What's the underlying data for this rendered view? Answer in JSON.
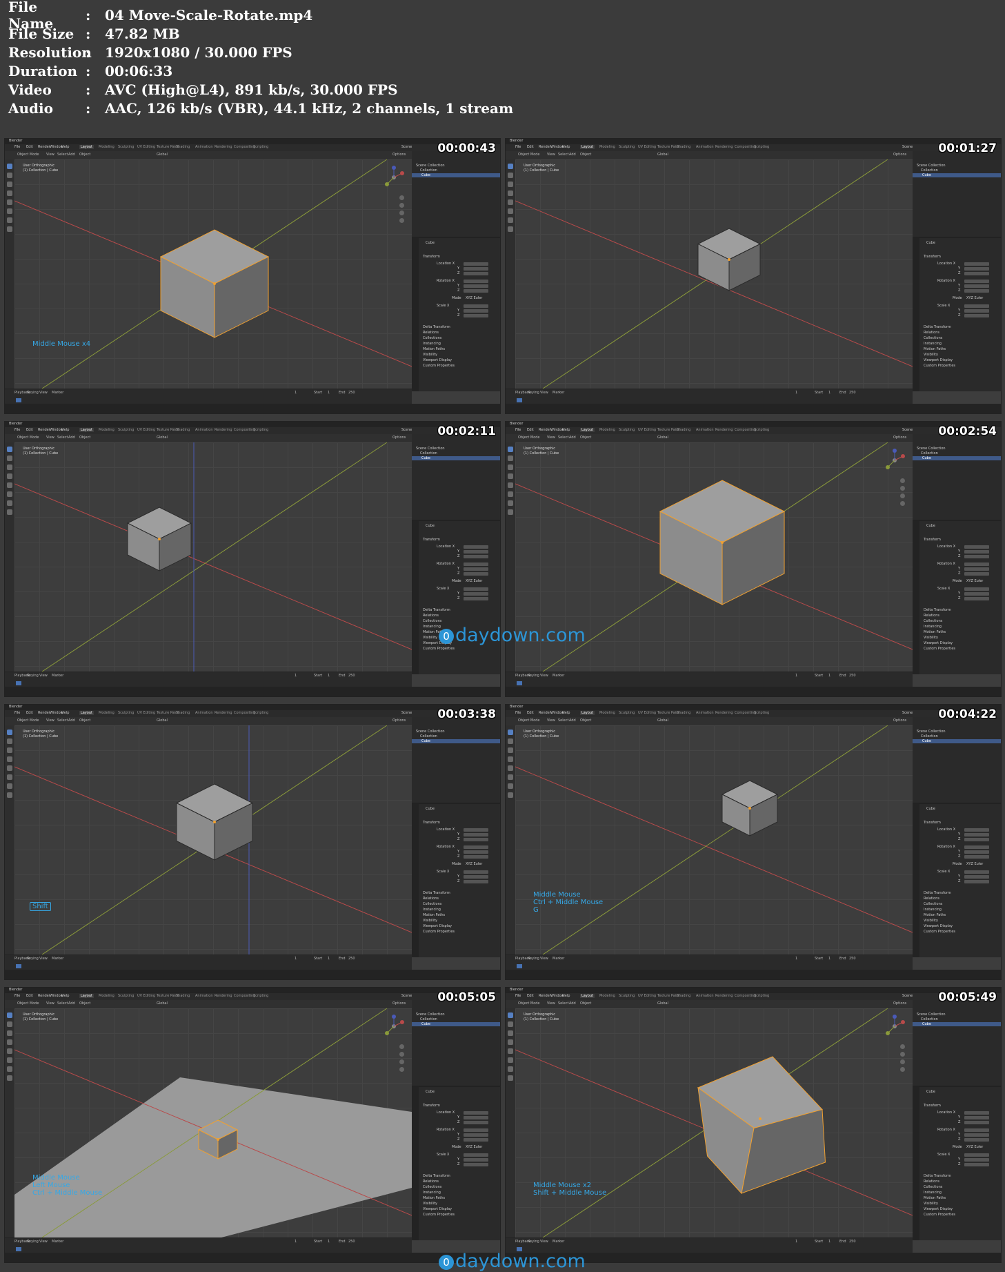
{
  "file_info": [
    {
      "label": "File Name",
      "value": "04 Move-Scale-Rotate.mp4"
    },
    {
      "label": "File Size",
      "value": "47.82 MB"
    },
    {
      "label": "Resolution",
      "value": "1920x1080 / 30.000 FPS"
    },
    {
      "label": "Duration",
      "value": "00:06:33"
    },
    {
      "label": "Video",
      "value": "AVC (High@L4), 891 kb/s, 30.000 FPS"
    },
    {
      "label": "Audio",
      "value": "AAC, 126 kb/s (VBR), 44.1 kHz, 2 channels, 1 stream"
    }
  ],
  "separator": ":",
  "app": {
    "title": "Blender",
    "menus": [
      "File",
      "Edit",
      "Render",
      "Window",
      "Help"
    ],
    "workspaces": [
      "Layout",
      "Modeling",
      "Sculpting",
      "UV Editing",
      "Texture Paint",
      "Shading",
      "Animation",
      "Rendering",
      "Compositing",
      "Scripting"
    ],
    "active_workspace": "Layout",
    "scene_label": "Scene",
    "options_label": "Options",
    "mode": "Object Mode",
    "view_menus": [
      "View",
      "Select",
      "Add",
      "Object"
    ],
    "orientation": "Global",
    "viewport_info": [
      "User Orthographic",
      "(1) Collection | Cube"
    ],
    "outliner": [
      "Scene Collection",
      "Collection",
      "Cube"
    ],
    "props_object": "Cube",
    "transform_label": "Transform",
    "location_labels": [
      "Location X",
      "Y",
      "Z"
    ],
    "rotation_labels": [
      "Rotation X",
      "Y",
      "Z"
    ],
    "mode_label": "Mode",
    "rotation_mode": "XYZ Euler",
    "scale_labels": [
      "Scale X",
      "Y",
      "Z"
    ],
    "sections": [
      "Delta Transform",
      "Relations",
      "Collections",
      "Instancing",
      "Motion Paths",
      "Visibility",
      "Viewport Display",
      "Custom Properties"
    ],
    "timeline_menus": [
      "Playback",
      "Keying",
      "View",
      "Marker"
    ],
    "start_label": "Start",
    "end_label": "End",
    "current_frame": "1",
    "start_frame": "1",
    "end_frame": "250"
  },
  "thumbnails": [
    {
      "timestamp": "00:00:43",
      "overlay": [
        "Middle Mouse x4"
      ]
    },
    {
      "timestamp": "00:01:27",
      "overlay": []
    },
    {
      "timestamp": "00:02:11",
      "overlay": []
    },
    {
      "timestamp": "00:02:54",
      "overlay": []
    },
    {
      "timestamp": "00:03:38",
      "overlay": [],
      "badge": "Shift"
    },
    {
      "timestamp": "00:04:22",
      "overlay": [
        "Middle Mouse",
        "Ctrl + Middle Mouse",
        "G"
      ]
    },
    {
      "timestamp": "00:05:05",
      "overlay": [
        "Middle Mouse",
        "Left Mouse",
        "Ctrl + Middle Mouse"
      ]
    },
    {
      "timestamp": "00:05:49",
      "overlay": [
        "Middle Mouse x2",
        "Shift + Middle Mouse"
      ]
    }
  ],
  "watermark": "daydown.com",
  "watermark_logo": "0",
  "colors": {
    "accent": "#4772b3",
    "overlay_text": "#36a8e6",
    "selection_outline": "#f0a030",
    "x_axis": "#b84a4a",
    "y_axis": "#8a9a3a",
    "z_axis": "#4a5ab8"
  }
}
